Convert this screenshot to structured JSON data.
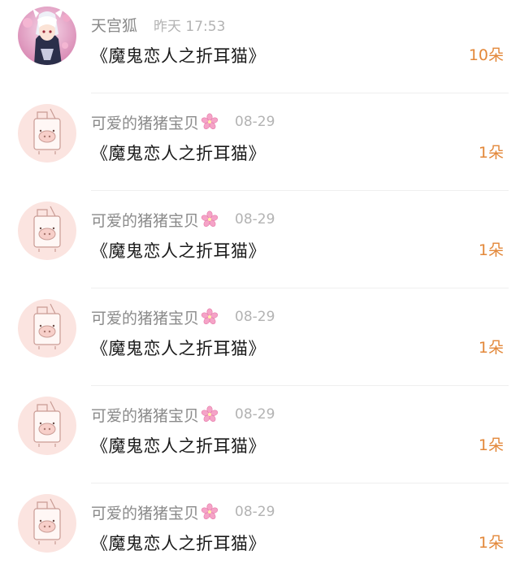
{
  "accent_color": "#e3883a",
  "gifts": [
    {
      "user": "天宫狐",
      "has_flower_badge": false,
      "time": "昨天 17:53",
      "item": "《魔鬼恋人之折耳猫》",
      "count": "10朵",
      "avatar": "anime-character-avatar"
    },
    {
      "user": "可爱的猪猪宝贝",
      "has_flower_badge": true,
      "time": "08-29",
      "item": "《魔鬼恋人之折耳猫》",
      "count": "1朵",
      "avatar": "pig-avatar"
    },
    {
      "user": "可爱的猪猪宝贝",
      "has_flower_badge": true,
      "time": "08-29",
      "item": "《魔鬼恋人之折耳猫》",
      "count": "1朵",
      "avatar": "pig-avatar"
    },
    {
      "user": "可爱的猪猪宝贝",
      "has_flower_badge": true,
      "time": "08-29",
      "item": "《魔鬼恋人之折耳猫》",
      "count": "1朵",
      "avatar": "pig-avatar"
    },
    {
      "user": "可爱的猪猪宝贝",
      "has_flower_badge": true,
      "time": "08-29",
      "item": "《魔鬼恋人之折耳猫》",
      "count": "1朵",
      "avatar": "pig-avatar"
    },
    {
      "user": "可爱的猪猪宝贝",
      "has_flower_badge": true,
      "time": "08-29",
      "item": "《魔鬼恋人之折耳猫》",
      "count": "1朵",
      "avatar": "pig-avatar"
    }
  ]
}
